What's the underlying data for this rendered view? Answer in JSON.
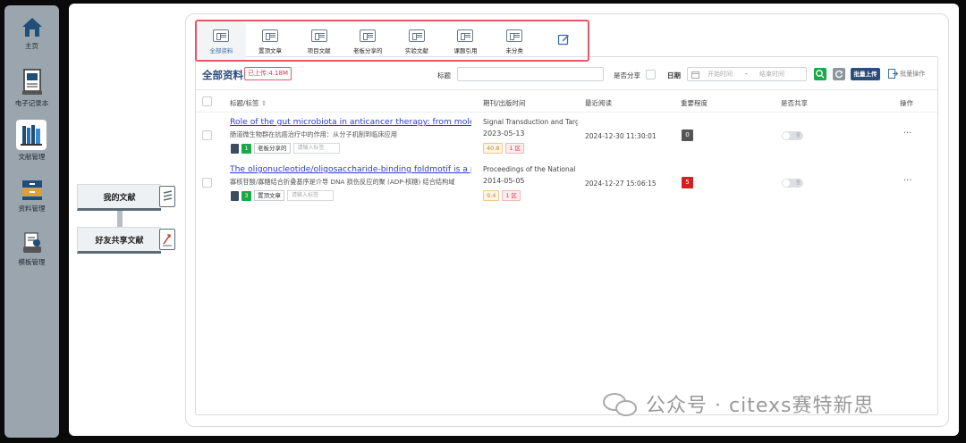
{
  "rail": {
    "items": [
      {
        "label": "主页",
        "icon": "home-icon"
      },
      {
        "label": "电子记录本",
        "icon": "notebook-icon"
      },
      {
        "label": "文献管理",
        "icon": "library-icon",
        "active": true
      },
      {
        "label": "资料管理",
        "icon": "archive-icon"
      },
      {
        "label": "模板管理",
        "icon": "template-icon"
      }
    ]
  },
  "subnav": {
    "my_docs": "我的文献",
    "shared_docs": "好友共享文献"
  },
  "tabs": [
    {
      "label": "全部资料",
      "active": true
    },
    {
      "label": "置顶文章"
    },
    {
      "label": "项目文献"
    },
    {
      "label": "老板分享的"
    },
    {
      "label": "实验文献"
    },
    {
      "label": "课题引用"
    },
    {
      "label": "未分类"
    }
  ],
  "toolbar": {
    "title": "全部资料",
    "uploaded": "已上传:4.18M",
    "title_label": "标题",
    "share_label": "是否分享",
    "date_label": "日期",
    "start_placeholder": "开始时间",
    "date_sep": "-",
    "end_placeholder": "结束时间",
    "upload_button": "批量上传",
    "batch_ops": "批量操作"
  },
  "table": {
    "headers": {
      "title": "标题/标签",
      "journal": "期刊/出版时间",
      "last_read": "最近阅读",
      "importance": "重要程度",
      "shared": "是否共享",
      "actions": "操作"
    },
    "rows": [
      {
        "title": "Role of the gut microbiota in anticancer therapy: from molec...",
        "subtitle": "肠道微生物群在抗癌治疗中的作用：从分子机制到临床应用",
        "tag_count": "1",
        "tag": "老板分享的",
        "tag_placeholder": "请输入标签",
        "journal": "Signal Transduction and Targeted Therapy",
        "pub_date": "2023-05-13",
        "impact": "40.8",
        "zone": "1 区",
        "last_read": "2024-12-30 11:30:01",
        "importance": "0",
        "importance_color": "#555555",
        "toggle": "否",
        "more": "···"
      },
      {
        "title": "The oligonucleotide/oligosaccharide-binding foldmotif is a p...",
        "subtitle": "寡核苷酸/寡糖结合折叠基序是介导 DNA 损伤反应的聚 (ADP-核糖) 结合结构域",
        "tag_count": "3",
        "tag": "置顶文章",
        "tag_placeholder": "请输入标签",
        "journal": "Proceedings of the National Academy of Sciences",
        "pub_date": "2014-05-05",
        "impact": "9.4",
        "zone": "1 区",
        "last_read": "2024-12-27 15:06:15",
        "importance": "5",
        "importance_color": "#d42020",
        "toggle": "否",
        "more": "···"
      }
    ]
  },
  "watermark": "公众号 · citexs赛特新思"
}
